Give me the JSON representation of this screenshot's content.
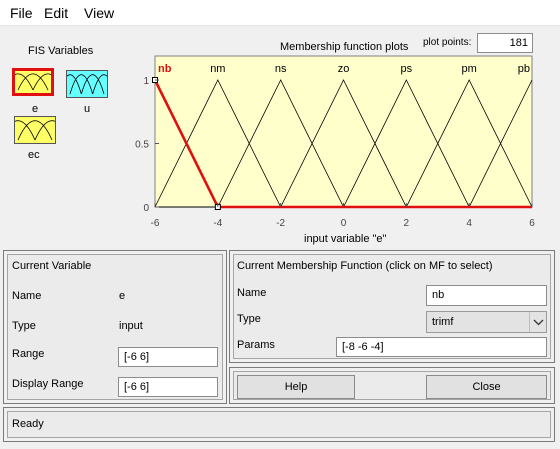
{
  "menu": {
    "items": [
      "File",
      "Edit",
      "View"
    ]
  },
  "fis_variables": {
    "title": "FIS Variables",
    "vars": [
      {
        "name": "e",
        "selected": true,
        "color": "#ffff66",
        "label_color": "#e01010"
      },
      {
        "name": "u",
        "selected": false,
        "color": "#66ffff",
        "label_color": "#000000"
      },
      {
        "name": "ec",
        "selected": false,
        "color": "#ffff66",
        "label_color": "#000000"
      }
    ]
  },
  "plot": {
    "title": "Membership function plots",
    "plot_points_label": "plot points:",
    "plot_points_value": "181",
    "xlabel": "input variable \"e\"",
    "background": "#ffffcc",
    "highlight_color": "#e01010",
    "x_ticks": [
      "-6",
      "-4",
      "-2",
      "0",
      "2",
      "4",
      "6"
    ],
    "y_ticks": [
      "0",
      "0.5",
      "1"
    ],
    "mf_labels": [
      "nb",
      "nm",
      "ns",
      "zo",
      "ps",
      "pm",
      "pb"
    ]
  },
  "chart_data": {
    "type": "line",
    "title": "Membership function plots",
    "xlabel": "input variable \"e\"",
    "ylabel": "",
    "xlim": [
      -6,
      6
    ],
    "ylim": [
      0,
      1
    ],
    "series": [
      {
        "name": "nb",
        "params": [
          -8,
          -6,
          -4
        ],
        "selected": true
      },
      {
        "name": "nm",
        "params": [
          -6,
          -4,
          -2
        ],
        "selected": false
      },
      {
        "name": "ns",
        "params": [
          -4,
          -2,
          0
        ],
        "selected": false
      },
      {
        "name": "zo",
        "params": [
          -2,
          0,
          2
        ],
        "selected": false
      },
      {
        "name": "ps",
        "params": [
          0,
          2,
          4
        ],
        "selected": false
      },
      {
        "name": "pm",
        "params": [
          2,
          4,
          6
        ],
        "selected": false
      },
      {
        "name": "pb",
        "params": [
          4,
          6,
          8
        ],
        "selected": false
      }
    ]
  },
  "current_variable": {
    "title": "Current Variable",
    "name_label": "Name",
    "name_value": "e",
    "type_label": "Type",
    "type_value": "input",
    "range_label": "Range",
    "range_value": "[-6 6]",
    "display_range_label": "Display Range",
    "display_range_value": "[-6 6]"
  },
  "current_mf": {
    "title": "Current Membership Function (click on MF to select)",
    "name_label": "Name",
    "name_value": "nb",
    "type_label": "Type",
    "type_value": "trimf",
    "params_label": "Params",
    "params_value": "[-8 -6 -4]"
  },
  "buttons": {
    "help": "Help",
    "close": "Close"
  },
  "status": {
    "text": "Ready"
  }
}
